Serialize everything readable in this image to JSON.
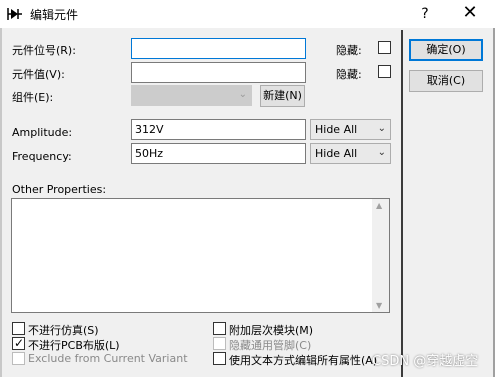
{
  "window": {
    "title": "编辑元件",
    "help": "?",
    "close": "✕"
  },
  "fields": {
    "designator_label": "元件位号(R):",
    "designator_value": "",
    "designator_hide_label": "隐藏:",
    "value_label": "元件值(V):",
    "value_value": "",
    "value_hide_label": "隐藏:",
    "group_label": "组件(E):",
    "group_value": "",
    "new_button": "新建(N)"
  },
  "properties": [
    {
      "label": "Amplitude:",
      "value": "312V",
      "visibility": "Hide All"
    },
    {
      "label": "Frequency:",
      "value": "50Hz",
      "visibility": "Hide All"
    }
  ],
  "other_properties": {
    "label": "Other Properties:",
    "text": ""
  },
  "options": [
    {
      "label": "不进行仿真(S)",
      "checked": false,
      "enabled": true
    },
    {
      "label": "不进行PCB布版(L)",
      "checked": true,
      "enabled": true
    },
    {
      "label": "Exclude from Current Variant",
      "checked": false,
      "enabled": false
    },
    {
      "label": "附加层次模块(M)",
      "checked": false,
      "enabled": true
    },
    {
      "label": "隐藏通用管脚(C)",
      "checked": false,
      "enabled": false
    },
    {
      "label": "使用文本方式编辑所有属性(A)",
      "checked": false,
      "enabled": true
    }
  ],
  "buttons": {
    "ok": "确定(O)",
    "cancel": "取消(C)"
  },
  "check_mark": "✓",
  "watermark": "CSDN @穿越虚空",
  "colors": {
    "accent": "#0078d7",
    "background": "#f0f0f0"
  }
}
